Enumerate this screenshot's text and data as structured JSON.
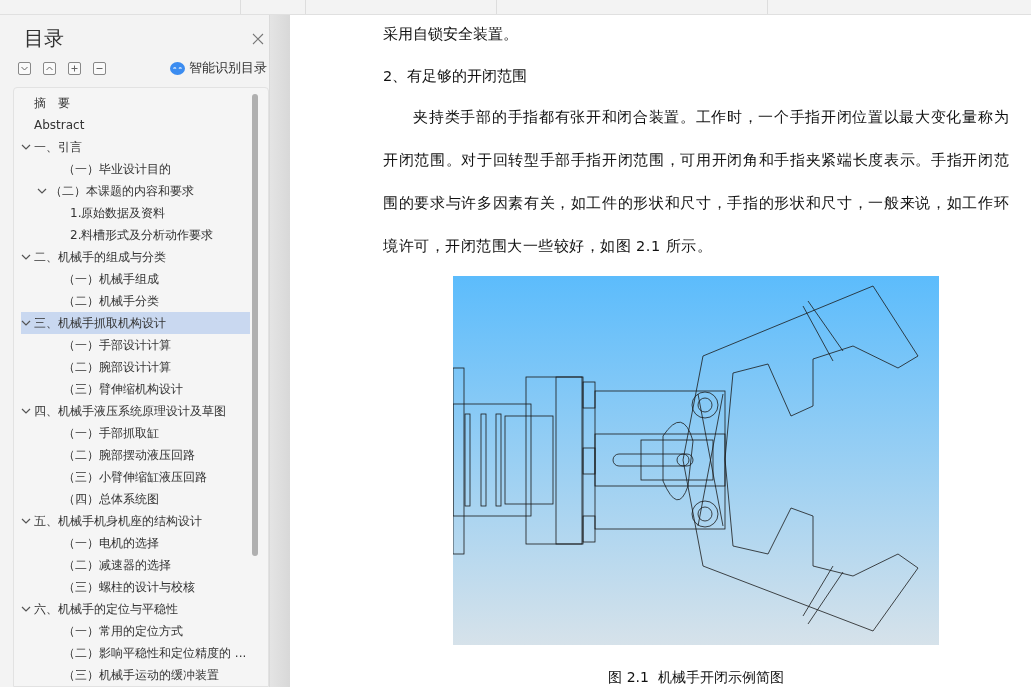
{
  "toc": {
    "title": "目录",
    "smart_label": "智能识别目录",
    "items": [
      {
        "label": "摘　要",
        "selected": false
      },
      {
        "label": "Abstract",
        "selected": false
      },
      {
        "label": "一、引言",
        "selected": false,
        "expanded": true,
        "children": [
          {
            "label": "（一）毕业设计目的",
            "selected": false
          },
          {
            "label": "（二）本课题的内容和要求",
            "selected": false,
            "expanded": true,
            "children": [
              {
                "label": "1.原始数据及资料",
                "selected": false
              },
              {
                "label": "2.料槽形式及分析动作要求",
                "selected": false
              }
            ]
          }
        ]
      },
      {
        "label": "二、机械手的组成与分类",
        "selected": false,
        "expanded": true,
        "children": [
          {
            "label": "（一）机械手组成",
            "selected": false
          },
          {
            "label": "（二）机械手分类",
            "selected": false
          }
        ]
      },
      {
        "label": "三、机械手抓取机构设计",
        "selected": true,
        "expanded": true,
        "children": [
          {
            "label": "（一）手部设计计算",
            "selected": false
          },
          {
            "label": "（二）腕部设计计算",
            "selected": false
          },
          {
            "label": "（三）臂伸缩机构设计",
            "selected": false
          }
        ]
      },
      {
        "label": "四、机械手液压系统原理设计及草图",
        "selected": false,
        "expanded": true,
        "children": [
          {
            "label": "（一）手部抓取缸",
            "selected": false
          },
          {
            "label": "（二）腕部摆动液压回路",
            "selected": false
          },
          {
            "label": "（三）小臂伸缩缸液压回路",
            "selected": false
          },
          {
            "label": "（四）总体系统图",
            "selected": false
          }
        ]
      },
      {
        "label": "五、机械手机身机座的结构设计",
        "selected": false,
        "expanded": true,
        "children": [
          {
            "label": "（一）电机的选择",
            "selected": false
          },
          {
            "label": "（二）减速器的选择",
            "selected": false
          },
          {
            "label": "（三）螺柱的设计与校核",
            "selected": false
          }
        ]
      },
      {
        "label": "六、机械手的定位与平稳性",
        "selected": false,
        "expanded": true,
        "children": [
          {
            "label": "（一）常用的定位方式",
            "selected": false
          },
          {
            "label": "（二）影响平稳性和定位精度的 ...",
            "selected": false
          },
          {
            "label": "（三）机械手运动的缓冲装置",
            "selected": false
          }
        ]
      }
    ]
  },
  "document": {
    "blocks": [
      {
        "kind": "line",
        "text": "采用自锁安全装置。"
      },
      {
        "kind": "heading",
        "text": "2、有足够的开闭范围"
      },
      {
        "kind": "paragraph",
        "text": "夹持类手部的手指都有张开和闭合装置。工作时，一个手指开闭位置以最大变化量称为开闭范围。对于回转型手部手指开闭范围，可用开闭角和手指夹紧端长度表示。手指开闭范围的要求与许多因素有关，如工件的形状和尺寸，手指的形状和尺寸，一般来说，如工作环境许可，开闭范围大一些较好，如图 2.1 所示。"
      },
      {
        "kind": "figure",
        "caption": "图 2.1  机械手开闭示例简图"
      }
    ]
  }
}
